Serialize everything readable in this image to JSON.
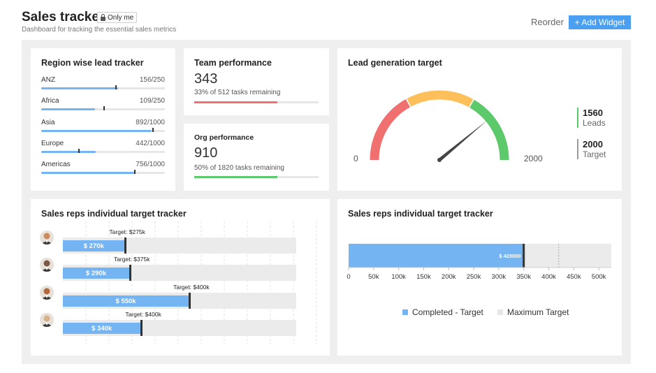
{
  "header": {
    "title": "Sales tracker",
    "badge": "Only me",
    "subtitle": "Dashboard for tracking the essential sales metrics",
    "reorder_label": "Reorder",
    "add_widget_label": "+ Add Widget",
    "accent": "#4a9ff0"
  },
  "region": {
    "title": "Region wise lead tracker",
    "rows": [
      {
        "name": "ANZ",
        "value": "156/250",
        "current": 156,
        "max": 250,
        "marker": 0.6
      },
      {
        "name": "Africa",
        "value": "109/250",
        "current": 109,
        "max": 250,
        "marker": 0.5
      },
      {
        "name": "Asia",
        "value": "892/1000",
        "current": 892,
        "max": 1000,
        "marker": 0.9
      },
      {
        "name": "Europe",
        "value": "442/1000",
        "current": 442,
        "max": 1000,
        "marker": 0.3
      },
      {
        "name": "Americas",
        "value": "756/1000",
        "current": 756,
        "max": 1000,
        "marker": 0.75
      }
    ]
  },
  "team": {
    "title": "Team performance",
    "value": "343",
    "sub": "33% of 512 tasks remaining",
    "progress": 0.67,
    "color": "#f07070"
  },
  "org": {
    "title": "Org performance",
    "value": "910",
    "sub": "50% of 1820 tasks remaining",
    "progress": 0.67,
    "color": "#5cc96a"
  },
  "lead": {
    "title": "Lead generation target",
    "min_label": "0",
    "max_label": "2000",
    "min": 0,
    "max": 2000,
    "value": 1560,
    "leads_value": "1560",
    "leads_label": "Leads",
    "target_value": "2000",
    "target_label": "Target",
    "colors": {
      "red": "#f07070",
      "yellow": "#fdbf5a",
      "green": "#5cc96a"
    }
  },
  "reps": {
    "title": "Sales reps individual target tracker",
    "rows": [
      {
        "value_label": "$ 270k",
        "target_label": "Target: $275k",
        "value": 270,
        "target": 275
      },
      {
        "value_label": "$ 290k",
        "target_label": "Target: $375k",
        "value": 290,
        "target": 375
      },
      {
        "value_label": "$ 550k",
        "target_label": "Target: $400k",
        "value": 550,
        "target": 400
      },
      {
        "value_label": "$ 340k",
        "target_label": "Target: $400k",
        "value": 340,
        "target": 400
      }
    ],
    "scale_max": 1020
  },
  "chart_data": {
    "type": "bar",
    "title": "Sales reps individual target tracker",
    "orientation": "horizontal",
    "value": 420000,
    "value_label": "$ 420000",
    "target": 350000,
    "maximum_target": 420000,
    "xlim": [
      0,
      525000
    ],
    "x_ticks": [
      "0",
      "50k",
      "100k",
      "150k",
      "200k",
      "250k",
      "300k",
      "350k",
      "400k",
      "450k",
      "500k"
    ],
    "x_tick_values": [
      0,
      50000,
      100000,
      150000,
      200000,
      250000,
      300000,
      350000,
      400000,
      450000,
      500000
    ],
    "legend": [
      "Completed - Target",
      "Maximum Target"
    ],
    "legend_placement": "bottom",
    "colors": {
      "completed": "#74b4f3",
      "maximum": "#ebebeb"
    }
  }
}
